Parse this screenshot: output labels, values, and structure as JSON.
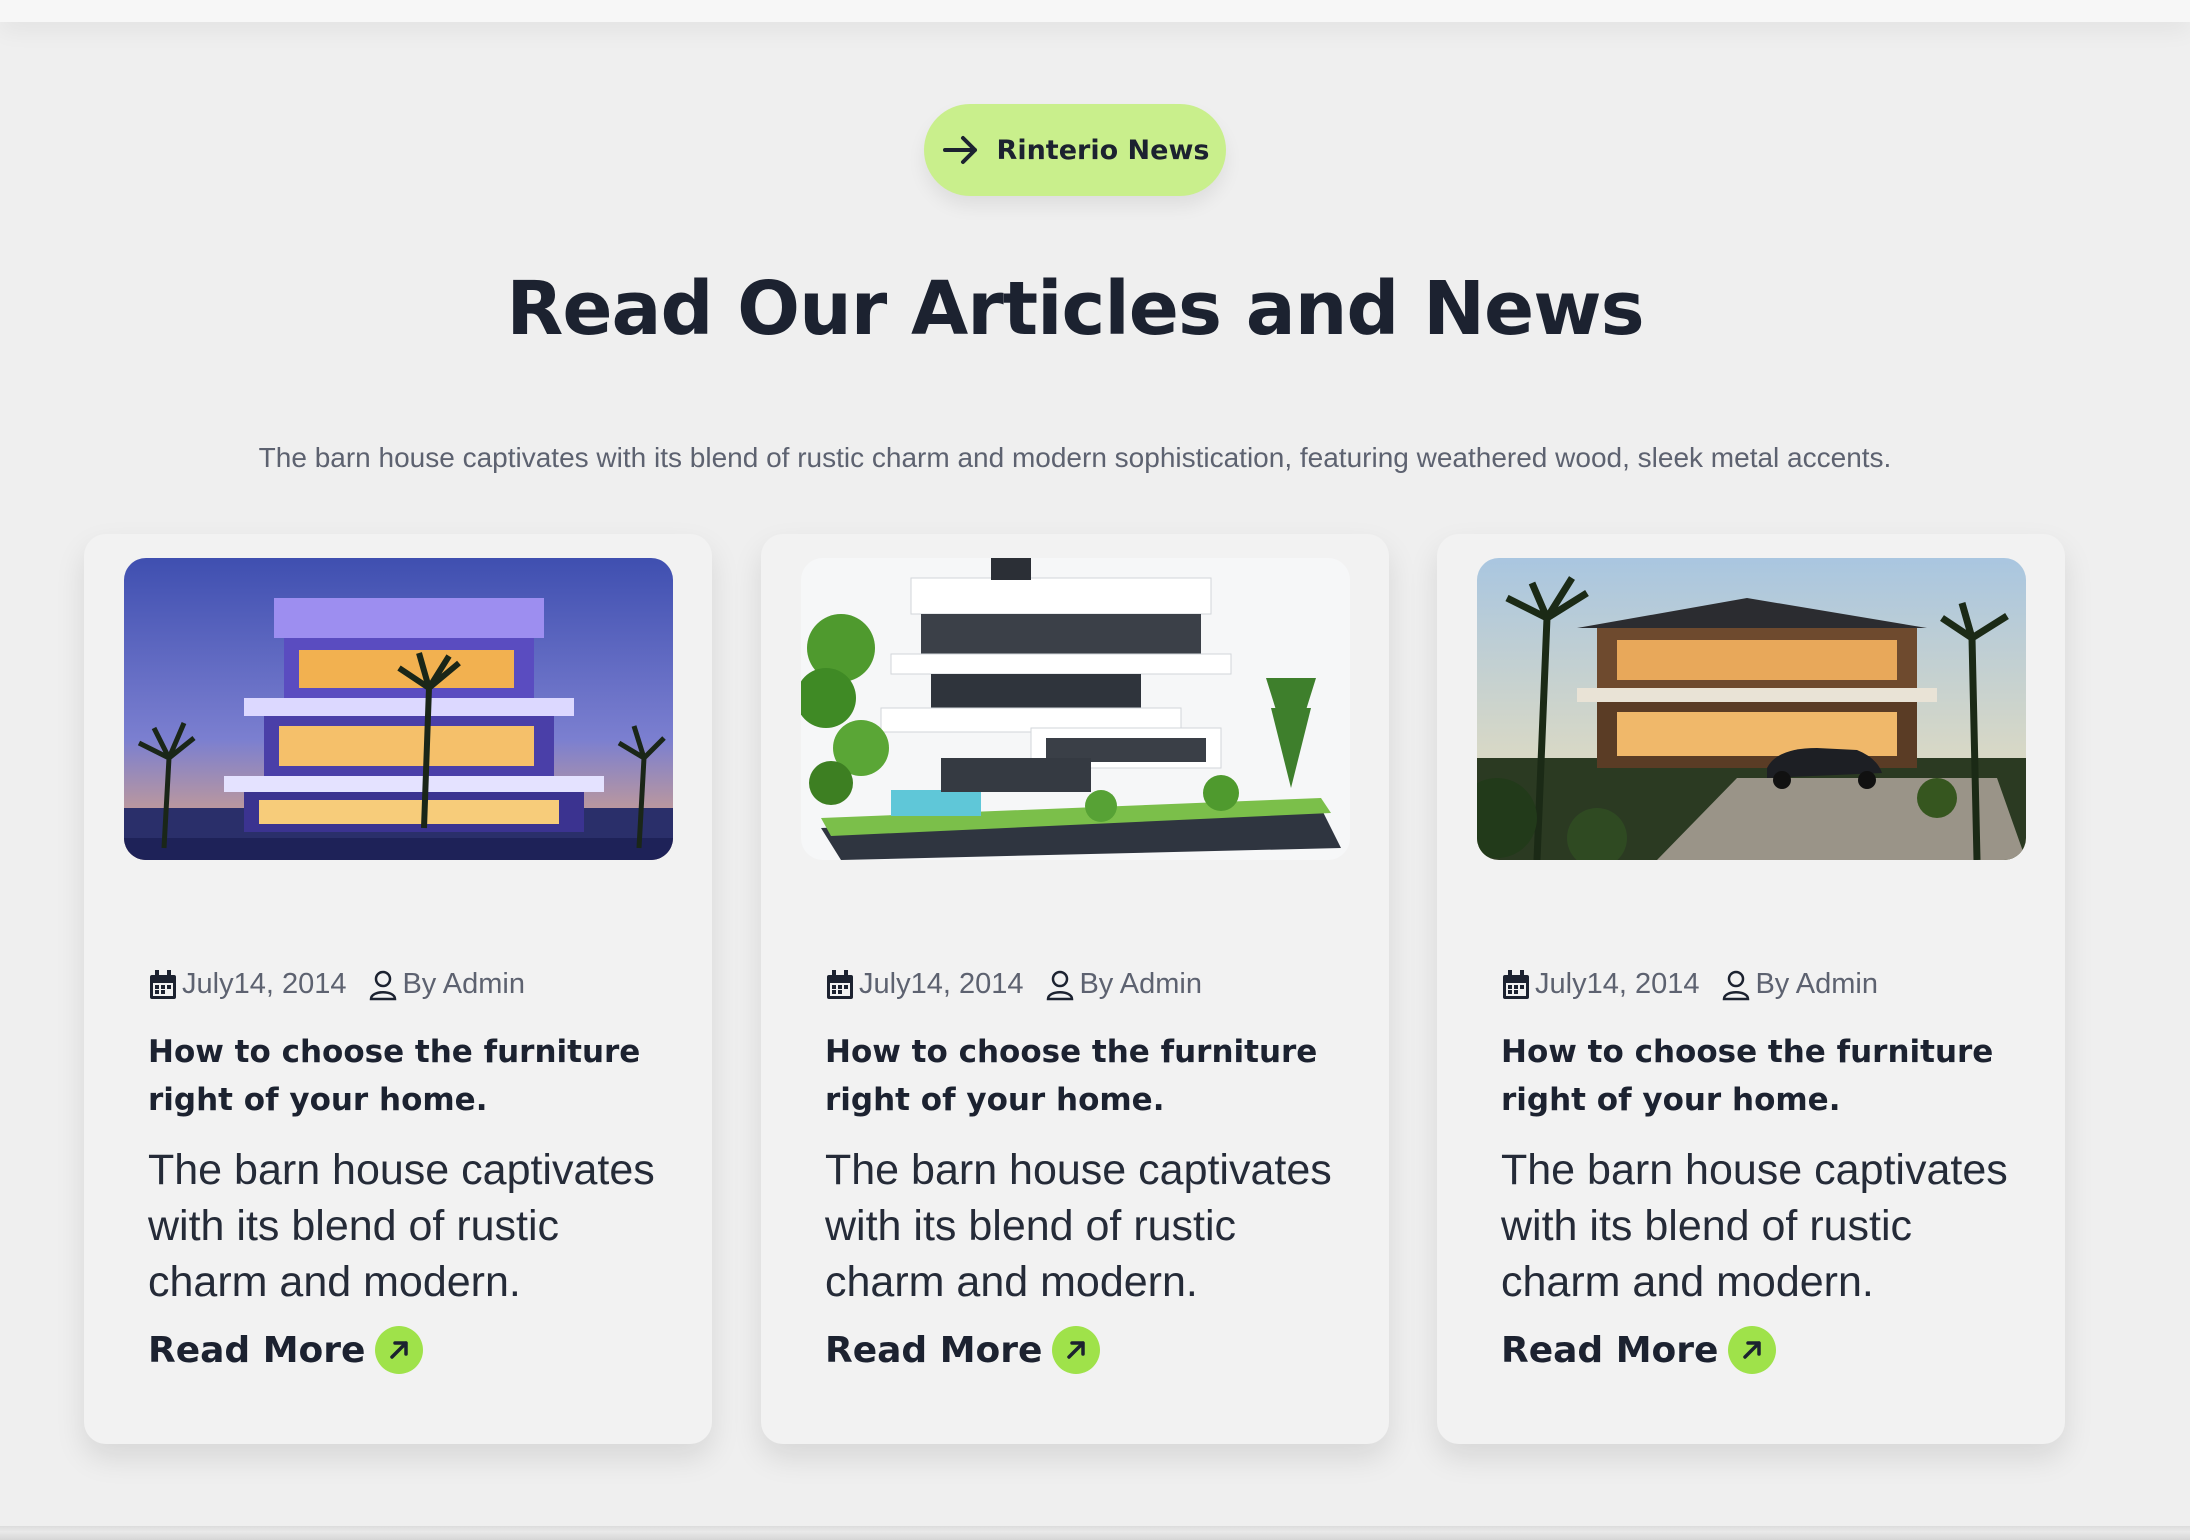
{
  "badge": {
    "label": "Rinterio News",
    "icon": "arrow-right-icon",
    "color": "#c9ef8c"
  },
  "section": {
    "title": "Read Our Articles and News",
    "subtitle": "The barn house captivates with its blend of rustic charm and modern sophistication, featuring weathered wood, sleek metal accents."
  },
  "articles": [
    {
      "image": "modern-villa-sunset-image",
      "date": "July14, 2014",
      "author": "By Admin",
      "title": "How to choose the furniture right of your home.",
      "excerpt": "The barn house captivates with its blend of rustic charm and modern.",
      "cta": "Read More"
    },
    {
      "image": "white-terraced-house-image",
      "date": "July14, 2014",
      "author": "By Admin",
      "title": "How to choose the furniture right of your home.",
      "excerpt": "The barn house captivates with its blend of rustic charm and modern.",
      "cta": "Read More"
    },
    {
      "image": "tropical-luxury-home-image",
      "date": "July14, 2014",
      "author": "By Admin",
      "title": "How to choose the furniture right of your home.",
      "excerpt": "The barn house captivates with its blend of rustic charm and modern.",
      "cta": "Read More"
    }
  ],
  "colors": {
    "accent": "#9fe24a",
    "text": "#1c2230",
    "muted": "#5d6270",
    "background": "#efefef"
  }
}
